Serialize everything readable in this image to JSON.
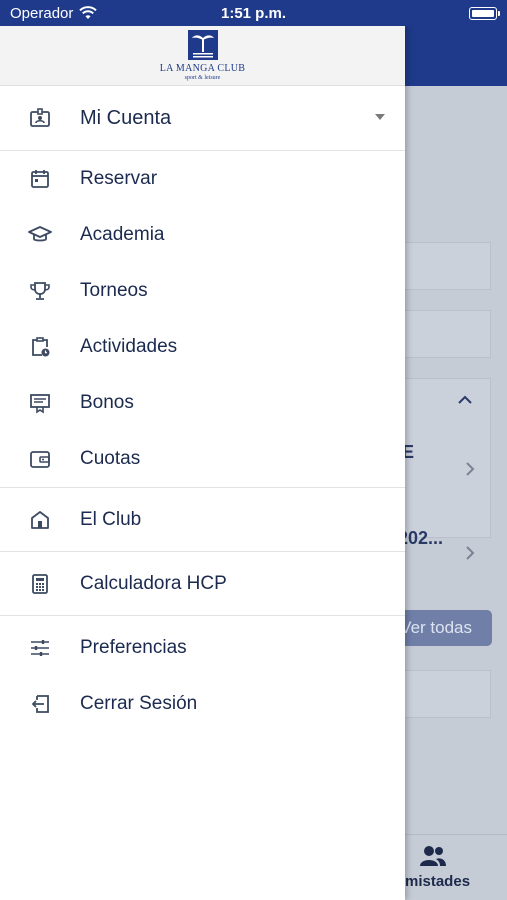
{
  "status_bar": {
    "carrier": "Operador",
    "time": "1:51 p.m."
  },
  "logo": {
    "name": "LA MANGA CLUB",
    "tagline": "sport & leisure"
  },
  "account": {
    "label": "Mi Cuenta"
  },
  "menu_group_1": [
    {
      "label": "Reservar",
      "icon": "calendar-icon"
    },
    {
      "label": "Academia",
      "icon": "graduation-cap-icon"
    },
    {
      "label": "Torneos",
      "icon": "trophy-icon"
    },
    {
      "label": "Actividades",
      "icon": "clipboard-clock-icon"
    },
    {
      "label": "Bonos",
      "icon": "voucher-icon"
    },
    {
      "label": "Cuotas",
      "icon": "wallet-icon"
    }
  ],
  "menu_group_2": [
    {
      "label": "El Club",
      "icon": "home-icon"
    }
  ],
  "menu_group_3": [
    {
      "label": "Calculadora HCP",
      "icon": "calculator-icon"
    }
  ],
  "menu_group_4": [
    {
      "label": "Preferencias",
      "icon": "sliders-icon"
    },
    {
      "label": "Cerrar Sesión",
      "icon": "logout-icon"
    }
  ],
  "background": {
    "partial_text_1": "E",
    "partial_text_2": "202...",
    "view_all_button": "Ver todas",
    "tab_label": "mistades"
  },
  "colors": {
    "brand": "#1f3a8a",
    "text": "#1b2a4e",
    "icon": "#3d4a60"
  }
}
